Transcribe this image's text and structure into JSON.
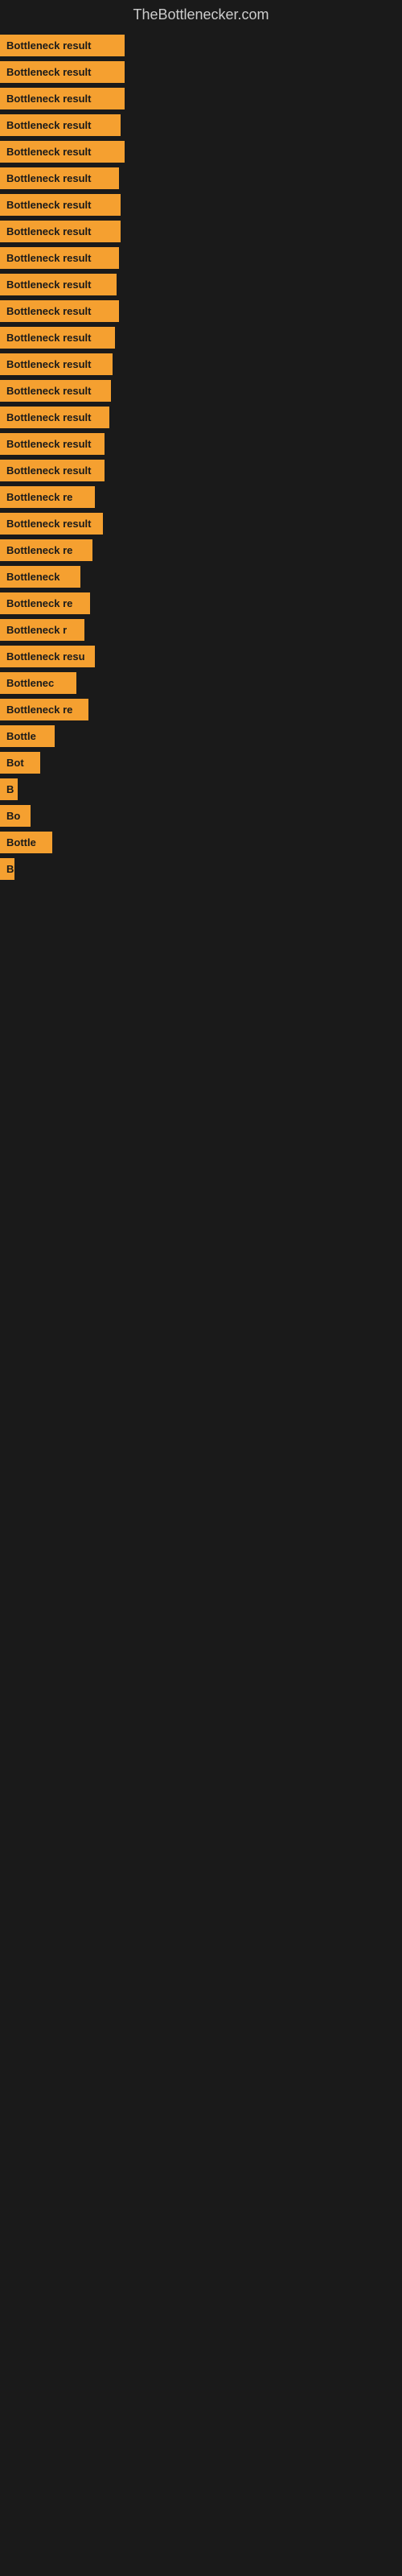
{
  "site": {
    "title": "TheBottlenecker.com"
  },
  "bars": [
    {
      "label": "Bottleneck result",
      "width": 155
    },
    {
      "label": "Bottleneck result",
      "width": 155
    },
    {
      "label": "Bottleneck result",
      "width": 155
    },
    {
      "label": "Bottleneck result",
      "width": 150
    },
    {
      "label": "Bottleneck result",
      "width": 155
    },
    {
      "label": "Bottleneck result",
      "width": 148
    },
    {
      "label": "Bottleneck result",
      "width": 150
    },
    {
      "label": "Bottleneck result",
      "width": 150
    },
    {
      "label": "Bottleneck result",
      "width": 148
    },
    {
      "label": "Bottleneck result",
      "width": 145
    },
    {
      "label": "Bottleneck result",
      "width": 148
    },
    {
      "label": "Bottleneck result",
      "width": 143
    },
    {
      "label": "Bottleneck result",
      "width": 140
    },
    {
      "label": "Bottleneck result",
      "width": 138
    },
    {
      "label": "Bottleneck result",
      "width": 136
    },
    {
      "label": "Bottleneck result",
      "width": 130
    },
    {
      "label": "Bottleneck result",
      "width": 130
    },
    {
      "label": "Bottleneck re",
      "width": 118
    },
    {
      "label": "Bottleneck result",
      "width": 128
    },
    {
      "label": "Bottleneck re",
      "width": 115
    },
    {
      "label": "Bottleneck",
      "width": 100
    },
    {
      "label": "Bottleneck re",
      "width": 112
    },
    {
      "label": "Bottleneck r",
      "width": 105
    },
    {
      "label": "Bottleneck resu",
      "width": 118
    },
    {
      "label": "Bottlenec",
      "width": 95
    },
    {
      "label": "Bottleneck re",
      "width": 110
    },
    {
      "label": "Bottle",
      "width": 68
    },
    {
      "label": "Bot",
      "width": 50
    },
    {
      "label": "B",
      "width": 22
    },
    {
      "label": "Bo",
      "width": 38
    },
    {
      "label": "Bottle",
      "width": 65
    },
    {
      "label": "B",
      "width": 18
    }
  ]
}
